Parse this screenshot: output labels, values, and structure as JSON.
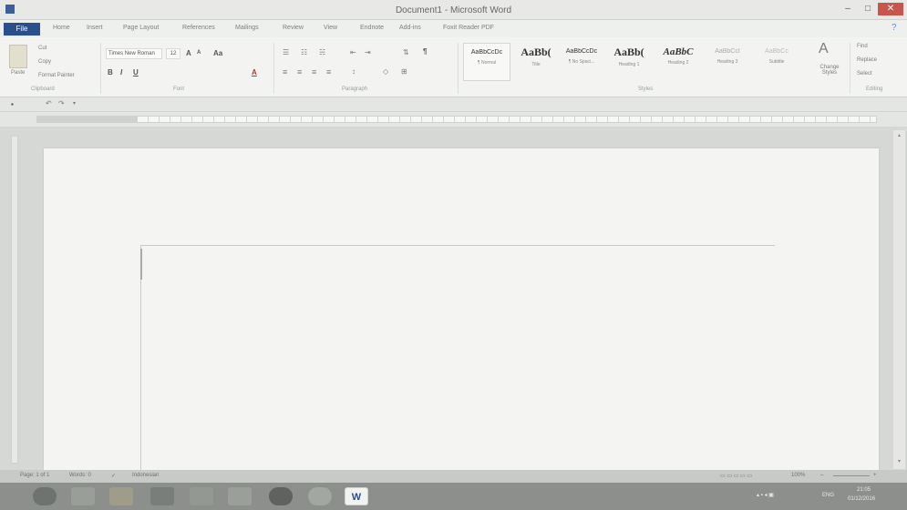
{
  "window": {
    "title": "Document1 - Microsoft Word",
    "minimize_label": "–",
    "maximize_label": "□",
    "close_label": "✕"
  },
  "tabs": {
    "file_label": "File",
    "items": [
      "Home",
      "Insert",
      "Page Layout",
      "References",
      "Mailings",
      "Review",
      "View",
      "Endnote",
      "Add-ins",
      "Foxit Reader PDF"
    ]
  },
  "ribbon": {
    "clipboard": {
      "paste_label": "Paste",
      "cut_label": "Cut",
      "copy_label": "Copy",
      "format_painter_label": "Format Painter",
      "group_label": "Clipboard"
    },
    "font": {
      "font_name": "Times New Roman",
      "font_size": "12",
      "bold": "B",
      "italic": "I",
      "underline": "U",
      "grow_font": "A",
      "shrink_font": "A",
      "change_case": "Aa",
      "font_color": "A",
      "group_label": "Font"
    },
    "paragraph": {
      "group_label": "Paragraph",
      "show_marks": "¶"
    },
    "styles": {
      "group_label": "Styles",
      "items": [
        {
          "sample": "AaBbCcDc",
          "name": "¶ Normal"
        },
        {
          "sample": "AaBb(",
          "name": "Title"
        },
        {
          "sample": "AaBbCcDc",
          "name": "¶ No Spaci..."
        },
        {
          "sample": "AaBb(",
          "name": "Heading 1"
        },
        {
          "sample": "AaBbC",
          "name": "Heading 2"
        },
        {
          "sample": "AaBbCcI",
          "name": "Heading 3"
        },
        {
          "sample": "AaBbCc",
          "name": "Subtitle"
        }
      ],
      "change_styles_label": "Change Styles"
    },
    "editing": {
      "find_label": "Find",
      "replace_label": "Replace",
      "select_label": "Select",
      "group_label": "Editing"
    }
  },
  "statusbar": {
    "page": "Page: 1 of 1",
    "words": "Words: 0",
    "language": "Indonesian",
    "zoom": "100%"
  },
  "taskbar": {
    "word_label": "W",
    "lang": "ENG",
    "time": "21:05",
    "date": "01/12/2016"
  }
}
